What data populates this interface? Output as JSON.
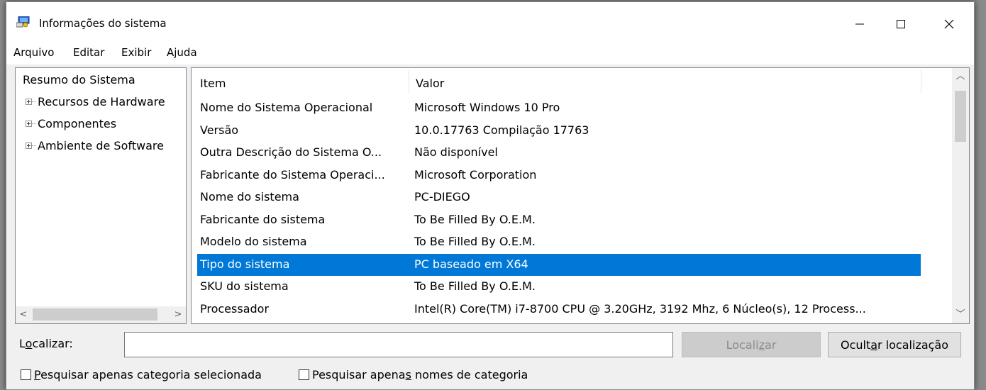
{
  "window": {
    "title": "Informações do sistema",
    "controls": {
      "minimize": "—",
      "maximize": "☐",
      "close": "✕"
    }
  },
  "menu": [
    "Arquivo",
    "Editar",
    "Exibir",
    "Ajuda"
  ],
  "tree": {
    "root": "Resumo do Sistema",
    "children": [
      "Recursos de Hardware",
      "Componentes",
      "Ambiente de Software"
    ]
  },
  "table": {
    "columns": [
      "Item",
      "Valor"
    ],
    "rows": [
      {
        "item": "Nome do Sistema Operacional",
        "value": "Microsoft Windows 10 Pro"
      },
      {
        "item": "Versão",
        "value": "10.0.17763 Compilação 17763"
      },
      {
        "item": "Outra Descrição do Sistema O...",
        "value": "Não disponível"
      },
      {
        "item": "Fabricante do Sistema Operaci...",
        "value": "Microsoft Corporation"
      },
      {
        "item": "Nome do sistema",
        "value": "PC-DIEGO"
      },
      {
        "item": "Fabricante do sistema",
        "value": "To Be Filled By O.E.M."
      },
      {
        "item": "Modelo do sistema",
        "value": "To Be Filled By O.E.M."
      },
      {
        "item": "Tipo do sistema",
        "value": "PC baseado em X64"
      },
      {
        "item": "SKU do sistema",
        "value": "To Be Filled By O.E.M."
      },
      {
        "item": "Processador",
        "value": "Intel(R) Core(TM) i7-8700 CPU @ 3.20GHz, 3192 Mhz, 6 Núcleo(s), 12 Process..."
      }
    ],
    "selected_index": 7
  },
  "find": {
    "label_pre": "L",
    "label_ul": "o",
    "label_post": "calizar:",
    "input_value": "",
    "find_button": {
      "pre": "Locali",
      "ul": "z",
      "post": "ar"
    },
    "hide_button": {
      "pre": "Ocult",
      "ul": "a",
      "post": "r localização"
    }
  },
  "checkboxes": [
    {
      "pre": "",
      "ul": "P",
      "post": "esquisar apenas categoria selecionada",
      "checked": false
    },
    {
      "pre": "Pesquisar apena",
      "ul": "s",
      "post": " nomes de categoria",
      "checked": false
    }
  ],
  "colors": {
    "selection": "#0078d7",
    "window_bg": "#f0f0f0"
  }
}
